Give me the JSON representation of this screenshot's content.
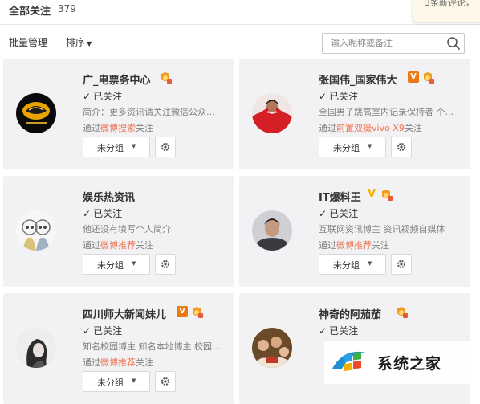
{
  "header": {
    "title": "全部关注",
    "count": "379"
  },
  "toast": {
    "text": "3条新评论，"
  },
  "toolbar": {
    "batch_label": "批量管理",
    "sort_label": "排序",
    "search_placeholder": "输入昵称或备注"
  },
  "cards": [
    {
      "name": "广_电票务中心",
      "status": "已关注",
      "desc": "简介：更多资讯请关注微信公众...",
      "via_prefix": "通过",
      "via_source": "微博搜索",
      "via_suffix": "关注",
      "group": "未分组",
      "avatar": "ticket-logo-avatar",
      "badges": [
        "medal-icon"
      ]
    },
    {
      "name": "张国伟_国家伟大",
      "status": "已关注",
      "desc": "全国男子跳高室内记录保持者 个...",
      "via_prefix": "通过",
      "via_source": "前置双摄vivo X9",
      "via_suffix": "关注",
      "group": "未分组",
      "avatar": "person-red-avatar",
      "badges": [
        "verified-orange-icon",
        "medal-icon"
      ]
    },
    {
      "name": "娱乐热资讯",
      "status": "已关注",
      "desc": "他还没有填写个人简介",
      "via_prefix": "通过",
      "via_source": "微博推荐",
      "via_suffix": "关注",
      "group": "未分组",
      "avatar": "cartoon-couple-avatar",
      "badges": []
    },
    {
      "name": "IT爆料王",
      "status": "已关注",
      "desc": "互联网资讯博主 资讯视频自媒体",
      "via_prefix": "通过",
      "via_source": "微博推荐",
      "via_suffix": "关注",
      "group": "未分组",
      "avatar": "man-portrait-avatar",
      "badges": [
        "verified-yellow-icon",
        "medal-icon"
      ]
    },
    {
      "name": "四川师大新闻妹儿",
      "status": "已关注",
      "desc": "知名校园博主 知名本地博主 校园...",
      "via_prefix": "通过",
      "via_source": "微博推荐",
      "via_suffix": "关注",
      "group": "未分组",
      "avatar": "woman-sketch-avatar",
      "badges": [
        "verified-orange-icon",
        "medal-icon"
      ]
    },
    {
      "name": "神奇的阿茄茄",
      "status": "已关注",
      "desc": "",
      "via_prefix": "",
      "via_source": "",
      "via_suffix": "",
      "group": "",
      "avatar": "group-photo-avatar",
      "badges": [
        "medal-icon"
      ]
    }
  ],
  "watermark": {
    "text": "系统之家"
  },
  "colors": {
    "card_bg": "#f2f2f5",
    "link": "#eb7350",
    "verified_orange": "#ea7a11",
    "verified_yellow": "#f2b100"
  }
}
